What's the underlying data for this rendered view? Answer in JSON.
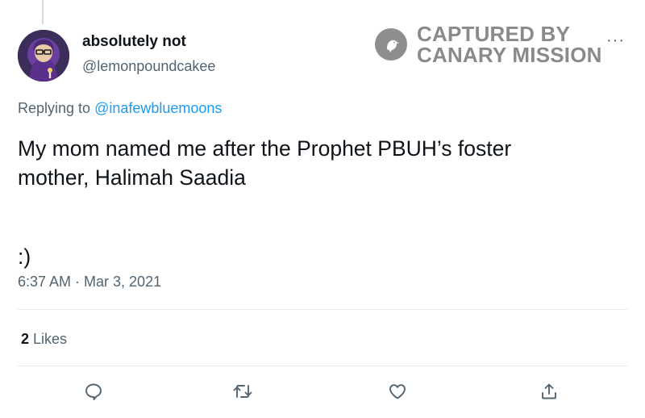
{
  "author": {
    "display_name": "absolutely not",
    "handle": "@lemonpoundcakee"
  },
  "watermark": {
    "line1": "CAPTURED BY",
    "line2": "CANARY MISSION"
  },
  "more_icon": "···",
  "reply": {
    "prefix": "Replying to ",
    "mention": "@inafewbluemoons"
  },
  "tweet": {
    "line1": "My mom named me after the Prophet PBUH’s foster",
    "line2": "mother, Halimah Saadia",
    "line3": ":)"
  },
  "timestamp": "6:37 AM · Mar 3, 2021",
  "engagement": {
    "likes_count": "2",
    "likes_label": " Likes"
  },
  "actions": [
    "reply-icon",
    "retweet-icon",
    "like-icon",
    "share-icon"
  ],
  "colors": {
    "link": "#1d9bf0",
    "secondary_text": "#536471",
    "primary_text": "#0f1419",
    "watermark": "#8a8a8a"
  }
}
